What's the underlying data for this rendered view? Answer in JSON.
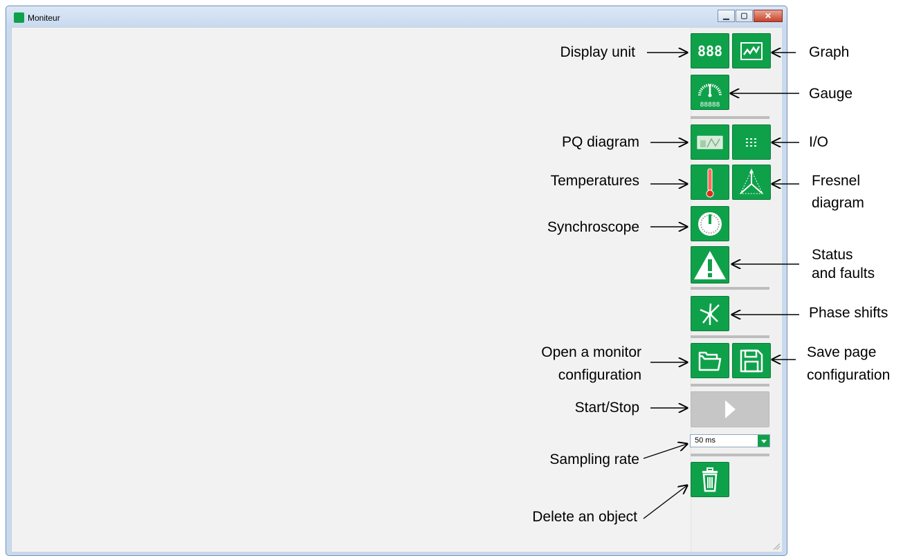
{
  "window": {
    "title": "Moniteur"
  },
  "toolbar": {
    "display_unit_text": "888",
    "gauge_text": "88888",
    "sampling_rate": {
      "selected": "50 ms"
    }
  },
  "annotations": {
    "display_unit": "Display unit",
    "graph": "Graph",
    "gauge": "Gauge",
    "pq_diagram": "PQ diagram",
    "io": "I/O",
    "temperatures": "Temperatures",
    "fresnel_line1": "Fresnel",
    "fresnel_line2": "diagram",
    "synchroscope": "Synchroscope",
    "status_line1": "Status",
    "status_line2": "and faults",
    "phase_shifts": "Phase shifts",
    "open_line1": "Open a monitor",
    "open_line2": "configuration",
    "save_line1": "Save page",
    "save_line2": "configuration",
    "start_stop": "Start/Stop",
    "sampling_rate": "Sampling rate",
    "delete": "Delete an object"
  },
  "colors": {
    "accent": "#0fa14a",
    "disabled": "#c6c6c6"
  }
}
